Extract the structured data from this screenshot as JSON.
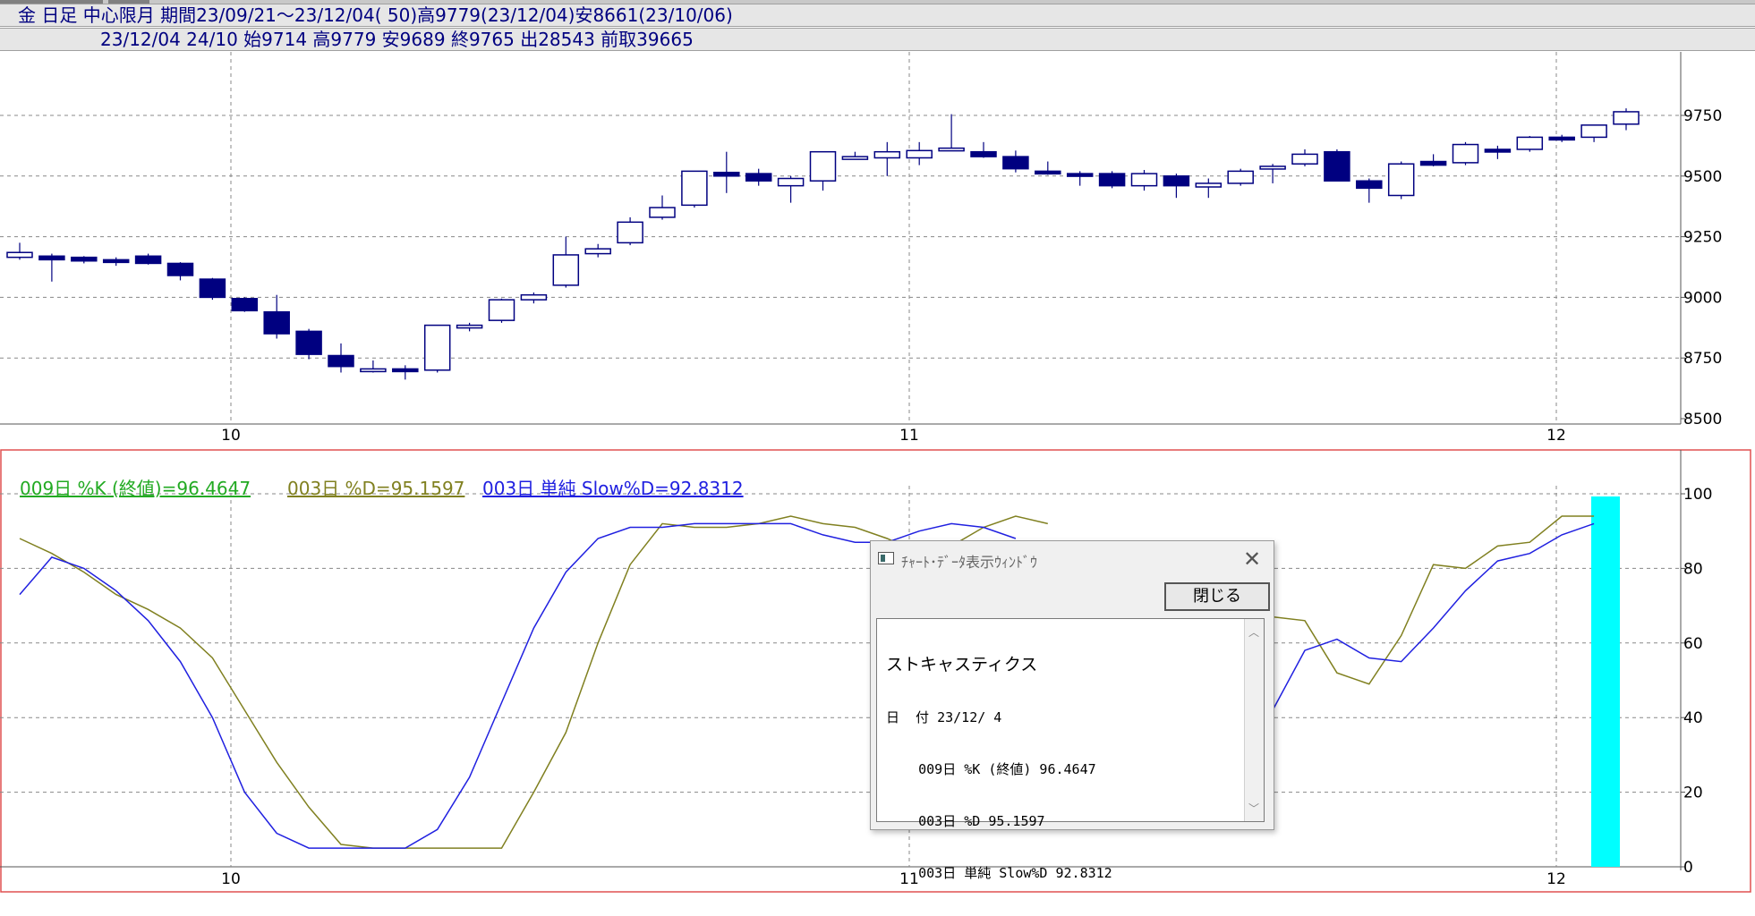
{
  "header": {
    "line1": "金 日足 中心限月 期間23/09/21～23/12/04( 50)高9779(23/12/04)安8661(23/10/06)",
    "line2": "23/12/04 24/10 始9714 高9779 安9689 終9765 出28543 前取39665"
  },
  "price_axis_labels": [
    "9750",
    "9500",
    "9250",
    "9000",
    "8750",
    "8500"
  ],
  "osc_axis_labels": [
    "100",
    "80",
    "60",
    "40",
    "20",
    "0"
  ],
  "month_labels": [
    "10",
    "11",
    "12"
  ],
  "legend": {
    "k": "009日 %K (終値)=96.4647",
    "d": "003日 %D=95.1597",
    "slow": "003日 単純 Slow%D=92.8312"
  },
  "colors": {
    "candle": "#000080",
    "k_line": "#808020",
    "slow_line": "#2020e0",
    "k_legend": "#22aa22",
    "d_legend": "#808020",
    "slow_legend": "#2020e0",
    "highlight": "#00ffff",
    "panel_border": "#e05050"
  },
  "dialog": {
    "title": "ﾁｬｰﾄ･ﾃﾞｰﾀ表示ｳｨﾝﾄﾞｳ",
    "close_icon": "close-x-icon",
    "close_button": "閉じる",
    "lines": [
      "ストキャスティクス",
      "日  付 23/12/ 4",
      "    009日 %K (終値) 96.4647",
      "    003日 %D 95.1597",
      "    003日 単純 Slow%D 92.8312"
    ]
  },
  "chart_data": [
    {
      "type": "candlestick",
      "title": "金 日足 中心限月",
      "ylim": [
        8500,
        9750
      ],
      "x_month_ticks": [
        "10",
        "11",
        "12"
      ],
      "grid": true,
      "ohlc": [
        [
          9165,
          9225,
          9155,
          9185
        ],
        [
          9170,
          9180,
          9065,
          9155
        ],
        [
          9165,
          9170,
          9140,
          9150
        ],
        [
          9155,
          9165,
          9130,
          9145
        ],
        [
          9170,
          9180,
          9135,
          9140
        ],
        [
          9140,
          9145,
          9070,
          9090
        ],
        [
          9075,
          9080,
          8990,
          9000
        ],
        [
          8995,
          9000,
          8940,
          8945
        ],
        [
          8940,
          9010,
          8830,
          8850
        ],
        [
          8860,
          8870,
          8745,
          8765
        ],
        [
          8760,
          8810,
          8690,
          8715
        ],
        [
          8700,
          8740,
          8690,
          8705
        ],
        [
          8705,
          8720,
          8661,
          8700
        ],
        [
          8700,
          8885,
          8690,
          8885
        ],
        [
          8885,
          8895,
          8860,
          8885
        ],
        [
          8905,
          8995,
          8895,
          8990
        ],
        [
          8990,
          9020,
          8975,
          9010
        ],
        [
          9050,
          9250,
          9040,
          9175
        ],
        [
          9180,
          9220,
          9165,
          9200
        ],
        [
          9225,
          9330,
          9215,
          9310
        ],
        [
          9330,
          9420,
          9320,
          9370
        ],
        [
          9380,
          9520,
          9370,
          9520
        ],
        [
          9515,
          9600,
          9430,
          9500
        ],
        [
          9510,
          9530,
          9460,
          9480
        ],
        [
          9460,
          9500,
          9390,
          9490
        ],
        [
          9480,
          9600,
          9440,
          9600
        ],
        [
          9580,
          9600,
          9575,
          9580
        ],
        [
          9575,
          9640,
          9500,
          9600
        ],
        [
          9575,
          9640,
          9545,
          9605
        ],
        [
          9615,
          9755,
          9610,
          9615
        ],
        [
          9600,
          9640,
          9575,
          9580
        ],
        [
          9580,
          9605,
          9515,
          9530
        ],
        [
          9520,
          9560,
          9505,
          9515
        ],
        [
          9510,
          9520,
          9460,
          9505
        ],
        [
          9510,
          9520,
          9450,
          9460
        ],
        [
          9460,
          9525,
          9440,
          9510
        ],
        [
          9500,
          9510,
          9410,
          9460
        ],
        [
          9455,
          9490,
          9410,
          9470
        ],
        [
          9470,
          9530,
          9460,
          9520
        ],
        [
          9530,
          9550,
          9470,
          9540
        ],
        [
          9550,
          9610,
          9540,
          9590
        ],
        [
          9600,
          9610,
          9480,
          9480
        ],
        [
          9480,
          9490,
          9390,
          9450
        ],
        [
          9420,
          9560,
          9405,
          9550
        ],
        [
          9560,
          9590,
          9540,
          9545
        ],
        [
          9555,
          9640,
          9545,
          9630
        ],
        [
          9610,
          9625,
          9570,
          9600
        ],
        [
          9610,
          9665,
          9600,
          9660
        ],
        [
          9660,
          9670,
          9640,
          9655
        ],
        [
          9660,
          9710,
          9640,
          9710
        ],
        [
          9714,
          9779,
          9689,
          9765
        ]
      ]
    },
    {
      "type": "line",
      "title": "ストキャスティクス",
      "ylim": [
        0,
        100
      ],
      "grid": true,
      "series": [
        {
          "name": "003日 %D",
          "values": [
            88,
            84,
            79,
            73,
            69,
            64,
            56,
            42,
            28,
            16,
            6,
            5,
            5,
            5,
            5,
            5,
            20,
            36,
            60,
            81,
            92,
            91,
            91,
            92,
            94,
            92,
            91,
            88,
            84,
            86,
            91,
            94,
            92
          ]
        },
        {
          "name": "003日 単純 Slow%D",
          "values": [
            73,
            83,
            80,
            74,
            66,
            55,
            40,
            20,
            9,
            5,
            5,
            5,
            5,
            10,
            24,
            44,
            64,
            79,
            88,
            91,
            91,
            92,
            92,
            92,
            92,
            89,
            87,
            87,
            90,
            92,
            91,
            88
          ]
        }
      ],
      "right_segment": {
        "d_values": [
          67,
          66,
          52,
          49,
          62,
          81,
          80,
          86,
          87,
          94,
          94
        ],
        "slow_values": [
          42,
          58,
          61,
          56,
          55,
          64,
          74,
          82,
          84,
          89,
          92
        ]
      }
    }
  ]
}
